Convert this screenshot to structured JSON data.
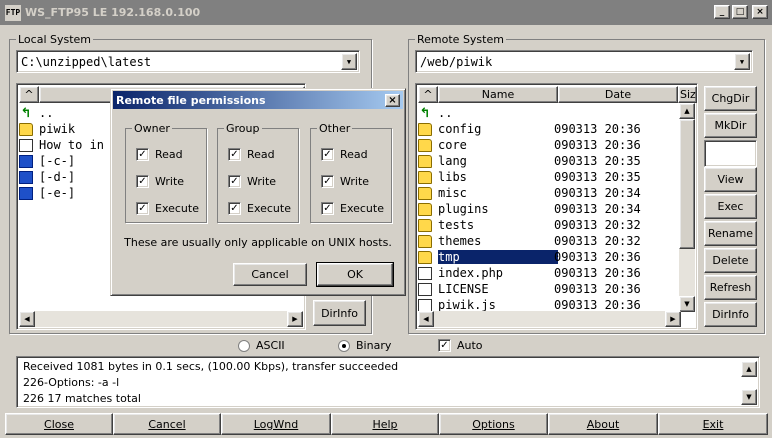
{
  "app": {
    "title": "WS_FTP95 LE 192.168.0.100",
    "icon_text": "FTP",
    "controls": [
      "_",
      "□",
      "×"
    ]
  },
  "local": {
    "label": "Local System",
    "path": "C:\\unzipped\\latest",
    "columns": [
      "^",
      "Name"
    ],
    "items": [
      {
        "name": "..",
        "icon": "up-arrow-icon"
      },
      {
        "name": "piwik",
        "icon": "folder-icon"
      },
      {
        "name": "How to in",
        "icon": "file-icon"
      },
      {
        "name": "[-c-]",
        "icon": "drive-icon"
      },
      {
        "name": "[-d-]",
        "icon": "drive-icon"
      },
      {
        "name": "[-e-]",
        "icon": "drive-icon"
      }
    ],
    "partial_buttons": [
      "DirInfo"
    ]
  },
  "remote": {
    "label": "Remote System",
    "path": "/web/piwik",
    "columns": [
      "^",
      "Name",
      "Date",
      "Size"
    ],
    "items": [
      {
        "name": "..",
        "date": "",
        "icon": "up-arrow-icon"
      },
      {
        "name": "config",
        "date": "090313 20:36",
        "icon": "folder-icon"
      },
      {
        "name": "core",
        "date": "090313 20:36",
        "icon": "folder-icon"
      },
      {
        "name": "lang",
        "date": "090313 20:35",
        "icon": "folder-icon"
      },
      {
        "name": "libs",
        "date": "090313 20:35",
        "icon": "folder-icon"
      },
      {
        "name": "misc",
        "date": "090313 20:34",
        "icon": "folder-icon"
      },
      {
        "name": "plugins",
        "date": "090313 20:34",
        "icon": "folder-icon"
      },
      {
        "name": "tests",
        "date": "090313 20:32",
        "icon": "folder-icon"
      },
      {
        "name": "themes",
        "date": "090313 20:32",
        "icon": "folder-icon"
      },
      {
        "name": "tmp",
        "date": "090313 20:36",
        "icon": "folder-icon",
        "selected": true
      },
      {
        "name": "index.php",
        "date": "090313 20:36",
        "icon": "file-icon"
      },
      {
        "name": "LICENSE",
        "date": "090313 20:36",
        "icon": "file-icon"
      },
      {
        "name": "piwik.js",
        "date": "090313 20:36",
        "icon": "file-icon"
      }
    ],
    "buttons": [
      "ChgDir",
      "MkDir",
      "",
      "View",
      "Exec",
      "Rename",
      "Delete",
      "Refresh",
      "DirInfo"
    ]
  },
  "transfer_mode": {
    "ascii": "ASCII",
    "binary": "Binary",
    "auto": "Auto",
    "selected": "binary",
    "auto_checked": true
  },
  "dialog": {
    "title": "Remote file permissions",
    "groups": [
      {
        "label": "Owner",
        "read": "Read",
        "write": "Write",
        "execute": "Execute"
      },
      {
        "label": "Group",
        "read": "Read",
        "write": "Write",
        "execute": "Execute"
      },
      {
        "label": "Other",
        "read": "Read",
        "write": "Write",
        "execute": "Execute"
      }
    ],
    "note": "These are usually only applicable on UNIX hosts.",
    "cancel": "Cancel",
    "ok": "OK"
  },
  "log": {
    "lines": [
      "Received 1081 bytes in 0.1 secs, (100.00 Kbps), transfer succeeded",
      "226-Options: -a -l",
      "226 17 matches total"
    ]
  },
  "bottom_buttons": [
    "Close",
    "Cancel",
    "LogWnd",
    "Help",
    "Options",
    "About",
    "Exit"
  ]
}
